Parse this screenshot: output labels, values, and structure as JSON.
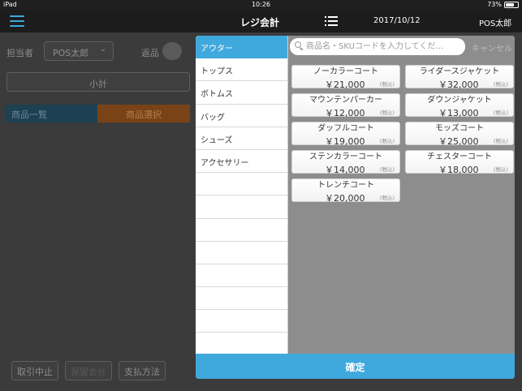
{
  "status_bar": {
    "device": "iPad",
    "time": "10:26",
    "battery": "73%",
    "battery_level": 0.73
  },
  "navbar": {
    "title": "レジ会計",
    "date": "2017/10/12",
    "user": "POS太郎"
  },
  "background": {
    "staff_label": "担当者",
    "staff_value": "POS太郎",
    "return_label": "返品",
    "subtotal": "小計",
    "tab_list": "商品一覧",
    "tab_select": "商品選択",
    "buttons": [
      "取引中止",
      "保留会計",
      "支払方法"
    ]
  },
  "categories": [
    "アウター",
    "トップス",
    "ボトムス",
    "バッグ",
    "シューズ",
    "アクセサリー"
  ],
  "active_category": "アウター",
  "search": {
    "placeholder": "商品名・SKUコードを入力してくだ…",
    "cancel": "キャンセル"
  },
  "products": [
    {
      "name": "ノーカラーコート",
      "price": "￥21,000",
      "tax": "(税込)"
    },
    {
      "name": "ライダースジャケット",
      "price": "￥32,000",
      "tax": "(税込)"
    },
    {
      "name": "マウンテンパーカー",
      "price": "￥12,000",
      "tax": "(税込)"
    },
    {
      "name": "ダウンジャケット",
      "price": "￥13,000",
      "tax": "(税込)"
    },
    {
      "name": "ダッフルコート",
      "price": "￥19,000",
      "tax": "(税込)"
    },
    {
      "name": "モッズコート",
      "price": "￥25,000",
      "tax": "(税込)"
    },
    {
      "name": "ステンカラーコート",
      "price": "￥14,000",
      "tax": "(税込)"
    },
    {
      "name": "チェスターコート",
      "price": "￥18,000",
      "tax": "(税込)"
    },
    {
      "name": "トレンチコート",
      "price": "￥20,000",
      "tax": "(税込)"
    }
  ],
  "confirm_label": "確定",
  "colors": {
    "accent": "#3fa9dd",
    "navbar": "#1c1c1c",
    "overlay": "#3b3b3b"
  }
}
